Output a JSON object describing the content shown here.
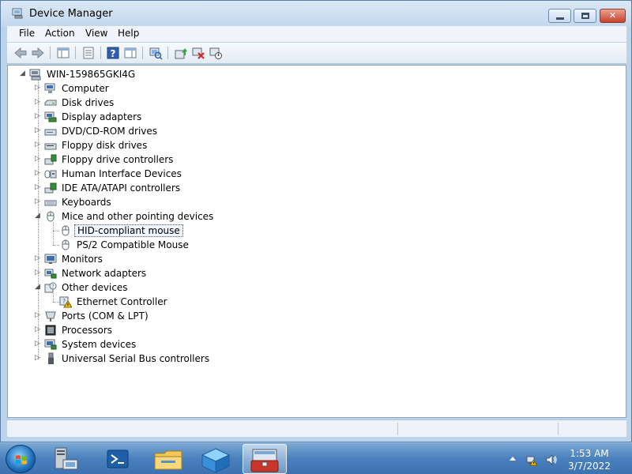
{
  "window": {
    "title": "Device Manager",
    "menu": [
      "File",
      "Action",
      "View",
      "Help"
    ]
  },
  "tree": {
    "root": "WIN-159865GKI4G",
    "categories": [
      {
        "label": "Computer",
        "icon": "computer-icon"
      },
      {
        "label": "Disk drives",
        "icon": "disk-drive-icon"
      },
      {
        "label": "Display adapters",
        "icon": "display-adapter-icon"
      },
      {
        "label": "DVD/CD-ROM drives",
        "icon": "dvd-drive-icon"
      },
      {
        "label": "Floppy disk drives",
        "icon": "floppy-drive-icon"
      },
      {
        "label": "Floppy drive controllers",
        "icon": "floppy-controller-icon"
      },
      {
        "label": "Human Interface Devices",
        "icon": "hid-icon"
      },
      {
        "label": "IDE ATA/ATAPI controllers",
        "icon": "ide-controller-icon"
      },
      {
        "label": "Keyboards",
        "icon": "keyboard-icon"
      },
      {
        "label": "Mice and other pointing devices",
        "icon": "mouse-icon",
        "expanded": true,
        "children": [
          {
            "label": "HID-compliant mouse",
            "icon": "mouse-icon",
            "selected": true
          },
          {
            "label": "PS/2 Compatible Mouse",
            "icon": "mouse-icon"
          }
        ]
      },
      {
        "label": "Monitors",
        "icon": "monitor-icon"
      },
      {
        "label": "Network adapters",
        "icon": "network-adapter-icon"
      },
      {
        "label": "Other devices",
        "icon": "other-devices-icon",
        "expanded": true,
        "children": [
          {
            "label": "Ethernet Controller",
            "icon": "unknown-device-warning-icon"
          }
        ]
      },
      {
        "label": "Ports (COM & LPT)",
        "icon": "port-icon"
      },
      {
        "label": "Processors",
        "icon": "processor-icon"
      },
      {
        "label": "System devices",
        "icon": "system-devices-icon"
      },
      {
        "label": "Universal Serial Bus controllers",
        "icon": "usb-icon"
      }
    ]
  },
  "taskbar": {
    "apps": [
      {
        "name": "server-manager-icon"
      },
      {
        "name": "powershell-icon"
      },
      {
        "name": "file-explorer-icon"
      },
      {
        "name": "network-icon"
      },
      {
        "name": "device-manager-taskbar-icon",
        "active": true
      }
    ],
    "time": "1:53 AM",
    "date": "3/7/2022"
  },
  "colors": {
    "window_frame": "#bcd4ea",
    "close_button": "#c6432e",
    "taskbar": "#4a80bd"
  }
}
